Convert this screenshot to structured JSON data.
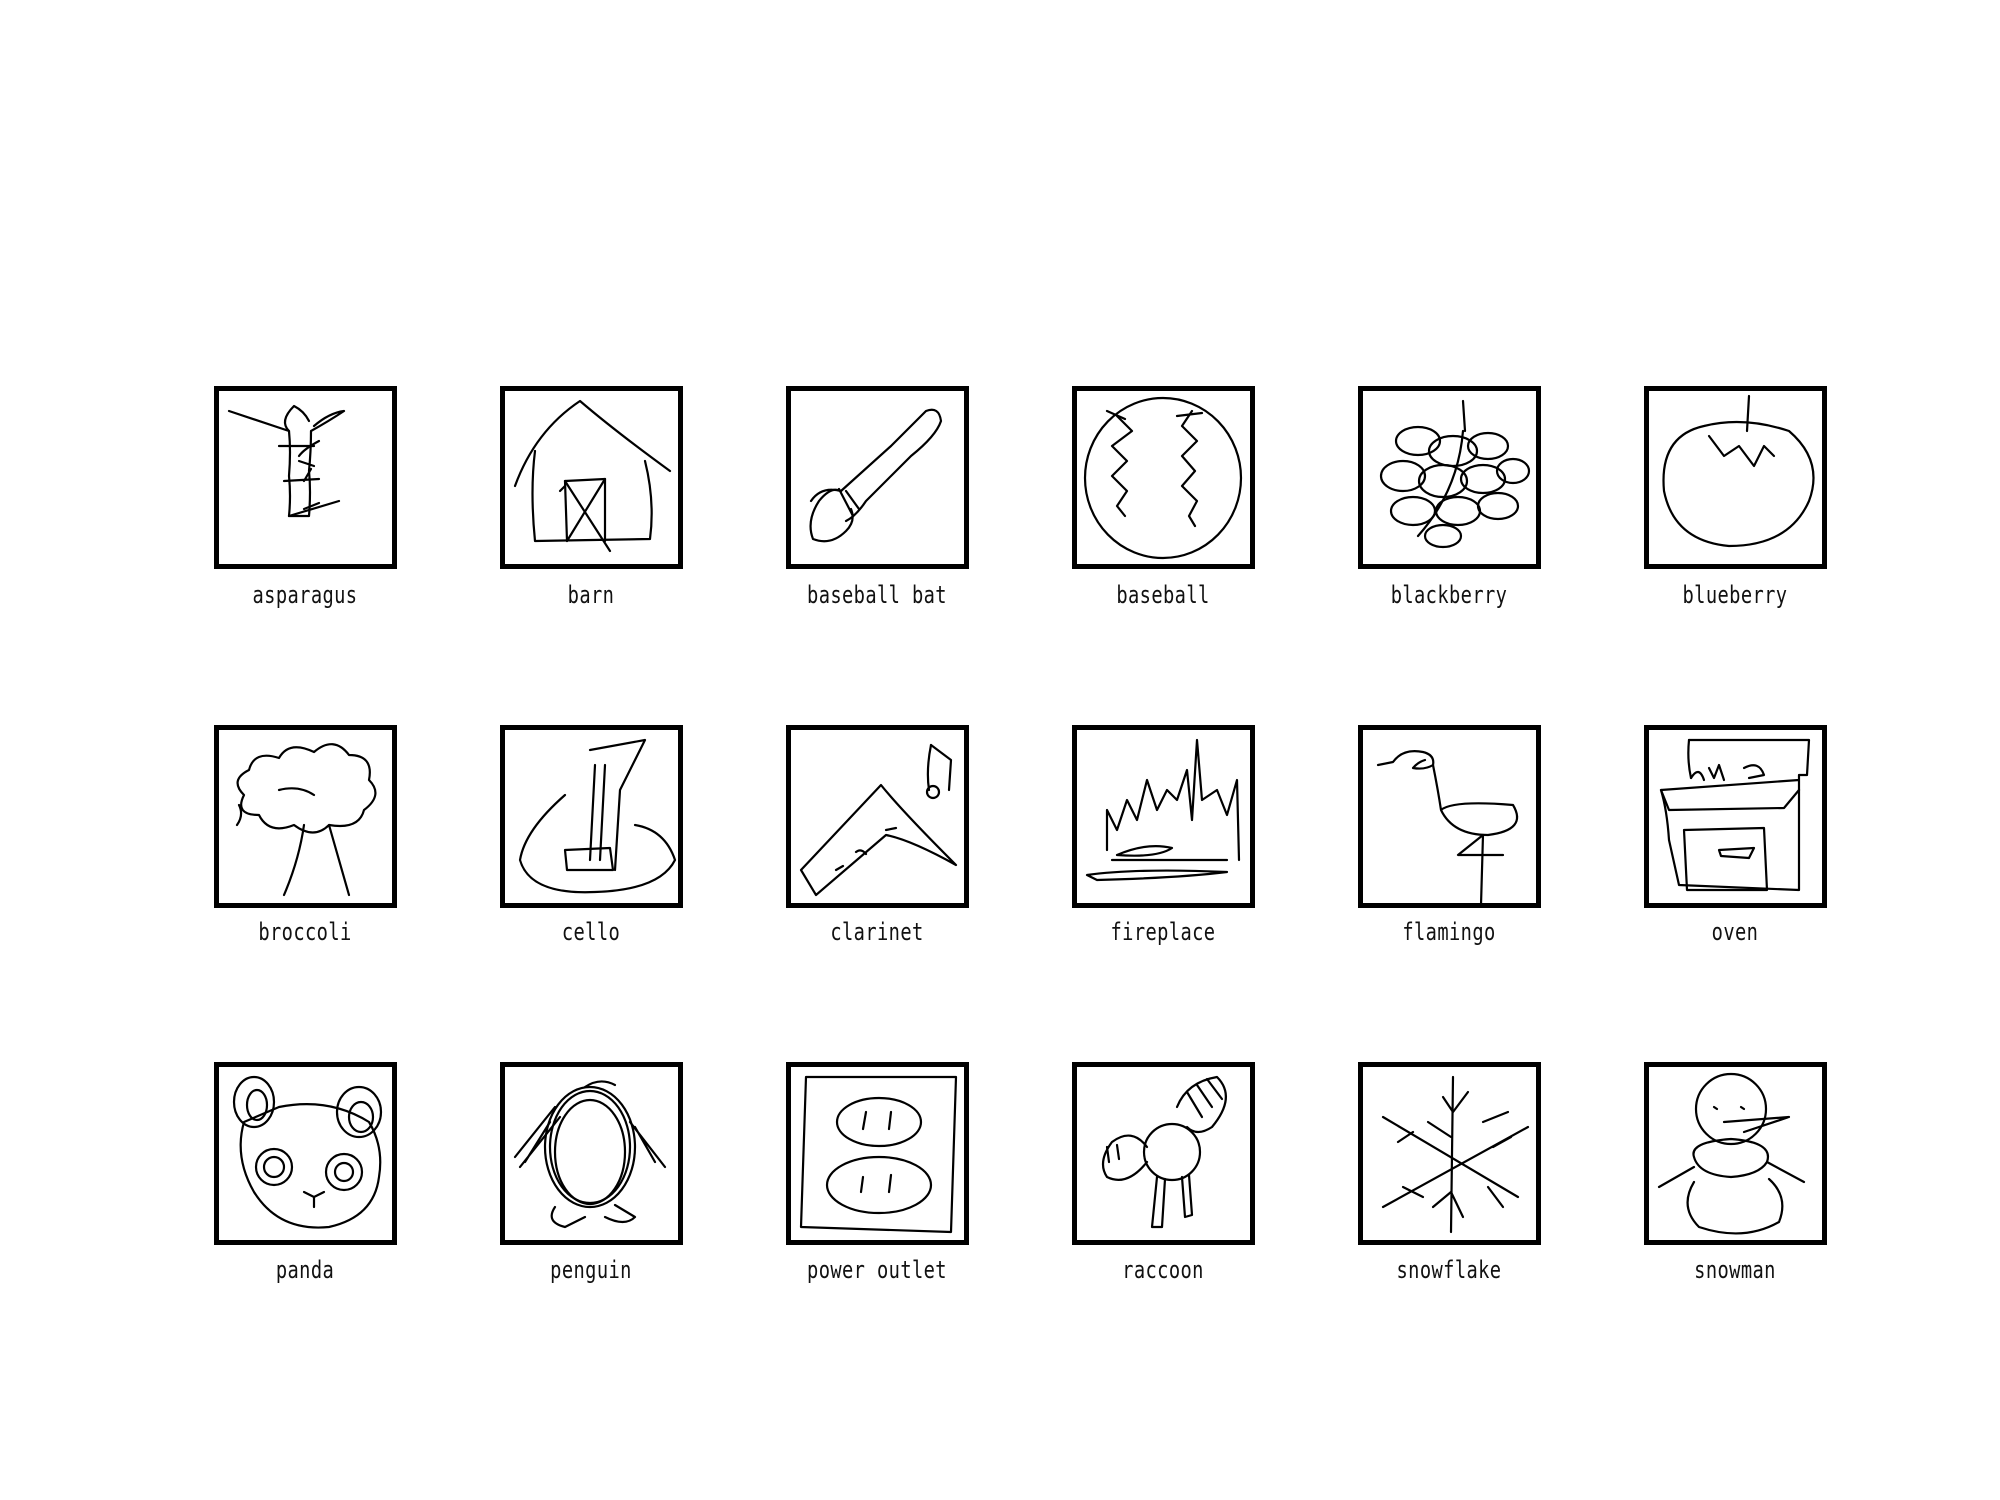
{
  "colors": {
    "background": "#ffffff",
    "ink": "#000000"
  },
  "items": [
    {
      "label": "asparagus",
      "icon": "asparagus-icon"
    },
    {
      "label": "barn",
      "icon": "barn-icon"
    },
    {
      "label": "baseball bat",
      "icon": "baseball-bat-icon"
    },
    {
      "label": "baseball",
      "icon": "baseball-icon"
    },
    {
      "label": "blackberry",
      "icon": "blackberry-icon"
    },
    {
      "label": "blueberry",
      "icon": "blueberry-icon"
    },
    {
      "label": "broccoli",
      "icon": "broccoli-icon"
    },
    {
      "label": "cello",
      "icon": "cello-icon"
    },
    {
      "label": "clarinet",
      "icon": "clarinet-icon"
    },
    {
      "label": "fireplace",
      "icon": "fireplace-icon"
    },
    {
      "label": "flamingo",
      "icon": "flamingo-icon"
    },
    {
      "label": "oven",
      "icon": "oven-icon"
    },
    {
      "label": "panda",
      "icon": "panda-icon"
    },
    {
      "label": "penguin",
      "icon": "penguin-icon"
    },
    {
      "label": "power outlet",
      "icon": "power-outlet-icon"
    },
    {
      "label": "raccoon",
      "icon": "raccoon-icon"
    },
    {
      "label": "snowflake",
      "icon": "snowflake-icon"
    },
    {
      "label": "snowman",
      "icon": "snowman-icon"
    }
  ]
}
